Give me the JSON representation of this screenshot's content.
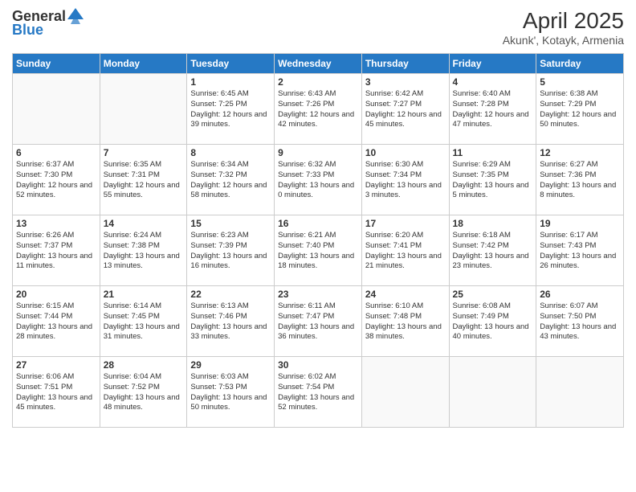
{
  "header": {
    "logo_line1": "General",
    "logo_line2": "Blue",
    "title": "April 2025",
    "subtitle": "Akunk', Kotayk, Armenia"
  },
  "calendar": {
    "weekdays": [
      "Sunday",
      "Monday",
      "Tuesday",
      "Wednesday",
      "Thursday",
      "Friday",
      "Saturday"
    ],
    "weeks": [
      [
        {
          "day": "",
          "info": ""
        },
        {
          "day": "",
          "info": ""
        },
        {
          "day": "1",
          "info": "Sunrise: 6:45 AM\nSunset: 7:25 PM\nDaylight: 12 hours and 39 minutes."
        },
        {
          "day": "2",
          "info": "Sunrise: 6:43 AM\nSunset: 7:26 PM\nDaylight: 12 hours and 42 minutes."
        },
        {
          "day": "3",
          "info": "Sunrise: 6:42 AM\nSunset: 7:27 PM\nDaylight: 12 hours and 45 minutes."
        },
        {
          "day": "4",
          "info": "Sunrise: 6:40 AM\nSunset: 7:28 PM\nDaylight: 12 hours and 47 minutes."
        },
        {
          "day": "5",
          "info": "Sunrise: 6:38 AM\nSunset: 7:29 PM\nDaylight: 12 hours and 50 minutes."
        }
      ],
      [
        {
          "day": "6",
          "info": "Sunrise: 6:37 AM\nSunset: 7:30 PM\nDaylight: 12 hours and 52 minutes."
        },
        {
          "day": "7",
          "info": "Sunrise: 6:35 AM\nSunset: 7:31 PM\nDaylight: 12 hours and 55 minutes."
        },
        {
          "day": "8",
          "info": "Sunrise: 6:34 AM\nSunset: 7:32 PM\nDaylight: 12 hours and 58 minutes."
        },
        {
          "day": "9",
          "info": "Sunrise: 6:32 AM\nSunset: 7:33 PM\nDaylight: 13 hours and 0 minutes."
        },
        {
          "day": "10",
          "info": "Sunrise: 6:30 AM\nSunset: 7:34 PM\nDaylight: 13 hours and 3 minutes."
        },
        {
          "day": "11",
          "info": "Sunrise: 6:29 AM\nSunset: 7:35 PM\nDaylight: 13 hours and 5 minutes."
        },
        {
          "day": "12",
          "info": "Sunrise: 6:27 AM\nSunset: 7:36 PM\nDaylight: 13 hours and 8 minutes."
        }
      ],
      [
        {
          "day": "13",
          "info": "Sunrise: 6:26 AM\nSunset: 7:37 PM\nDaylight: 13 hours and 11 minutes."
        },
        {
          "day": "14",
          "info": "Sunrise: 6:24 AM\nSunset: 7:38 PM\nDaylight: 13 hours and 13 minutes."
        },
        {
          "day": "15",
          "info": "Sunrise: 6:23 AM\nSunset: 7:39 PM\nDaylight: 13 hours and 16 minutes."
        },
        {
          "day": "16",
          "info": "Sunrise: 6:21 AM\nSunset: 7:40 PM\nDaylight: 13 hours and 18 minutes."
        },
        {
          "day": "17",
          "info": "Sunrise: 6:20 AM\nSunset: 7:41 PM\nDaylight: 13 hours and 21 minutes."
        },
        {
          "day": "18",
          "info": "Sunrise: 6:18 AM\nSunset: 7:42 PM\nDaylight: 13 hours and 23 minutes."
        },
        {
          "day": "19",
          "info": "Sunrise: 6:17 AM\nSunset: 7:43 PM\nDaylight: 13 hours and 26 minutes."
        }
      ],
      [
        {
          "day": "20",
          "info": "Sunrise: 6:15 AM\nSunset: 7:44 PM\nDaylight: 13 hours and 28 minutes."
        },
        {
          "day": "21",
          "info": "Sunrise: 6:14 AM\nSunset: 7:45 PM\nDaylight: 13 hours and 31 minutes."
        },
        {
          "day": "22",
          "info": "Sunrise: 6:13 AM\nSunset: 7:46 PM\nDaylight: 13 hours and 33 minutes."
        },
        {
          "day": "23",
          "info": "Sunrise: 6:11 AM\nSunset: 7:47 PM\nDaylight: 13 hours and 36 minutes."
        },
        {
          "day": "24",
          "info": "Sunrise: 6:10 AM\nSunset: 7:48 PM\nDaylight: 13 hours and 38 minutes."
        },
        {
          "day": "25",
          "info": "Sunrise: 6:08 AM\nSunset: 7:49 PM\nDaylight: 13 hours and 40 minutes."
        },
        {
          "day": "26",
          "info": "Sunrise: 6:07 AM\nSunset: 7:50 PM\nDaylight: 13 hours and 43 minutes."
        }
      ],
      [
        {
          "day": "27",
          "info": "Sunrise: 6:06 AM\nSunset: 7:51 PM\nDaylight: 13 hours and 45 minutes."
        },
        {
          "day": "28",
          "info": "Sunrise: 6:04 AM\nSunset: 7:52 PM\nDaylight: 13 hours and 48 minutes."
        },
        {
          "day": "29",
          "info": "Sunrise: 6:03 AM\nSunset: 7:53 PM\nDaylight: 13 hours and 50 minutes."
        },
        {
          "day": "30",
          "info": "Sunrise: 6:02 AM\nSunset: 7:54 PM\nDaylight: 13 hours and 52 minutes."
        },
        {
          "day": "",
          "info": ""
        },
        {
          "day": "",
          "info": ""
        },
        {
          "day": "",
          "info": ""
        }
      ]
    ]
  }
}
